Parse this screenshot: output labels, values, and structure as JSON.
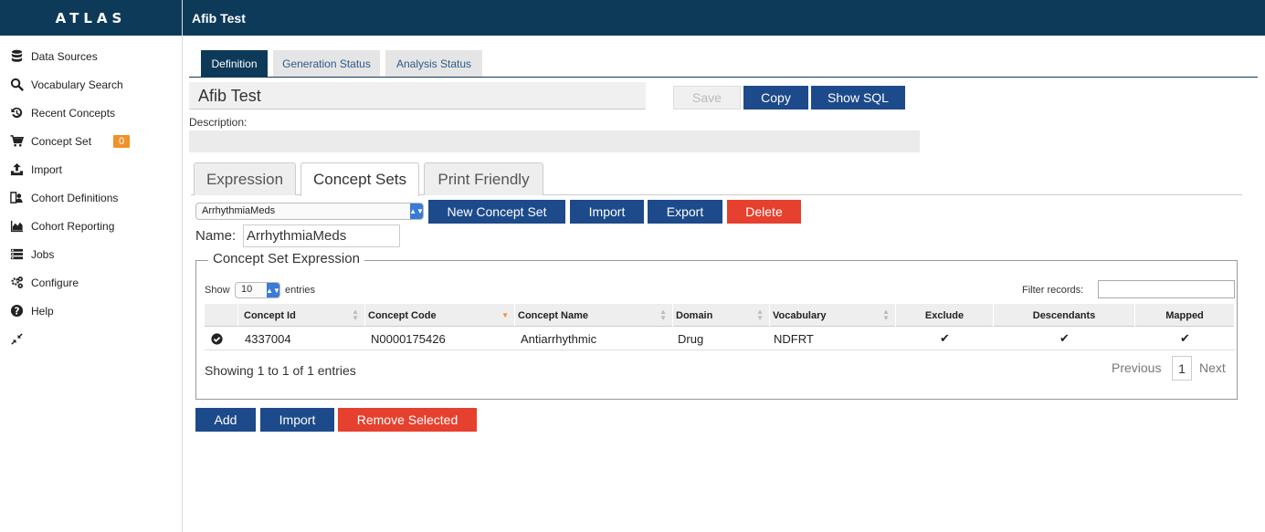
{
  "app": {
    "logo": "ATLAS",
    "page_title": "Afib Test"
  },
  "sidebar": {
    "items": [
      {
        "label": "Data Sources",
        "icon": "database-icon"
      },
      {
        "label": "Vocabulary Search",
        "icon": "search-icon"
      },
      {
        "label": "Recent Concepts",
        "icon": "history-icon"
      },
      {
        "label": "Concept Set",
        "icon": "cart-icon",
        "badge": "0"
      },
      {
        "label": "Import",
        "icon": "upload-icon"
      },
      {
        "label": "Cohort Definitions",
        "icon": "cohort-icon"
      },
      {
        "label": "Cohort Reporting",
        "icon": "area-chart-icon"
      },
      {
        "label": "Jobs",
        "icon": "list-icon"
      },
      {
        "label": "Configure",
        "icon": "gears-icon"
      },
      {
        "label": "Help",
        "icon": "question-icon"
      },
      {
        "label": "",
        "icon": "compress-icon"
      }
    ]
  },
  "top_tabs": [
    "Definition",
    "Generation Status",
    "Analysis Status"
  ],
  "definition": {
    "title": "Afib Test",
    "save_label": "Save",
    "copy_label": "Copy",
    "show_sql_label": "Show SQL",
    "description_label": "Description:",
    "description_value": ""
  },
  "inner_tabs": [
    "Expression",
    "Concept Sets",
    "Print Friendly"
  ],
  "concept_sets": {
    "selected": "ArrhythmiaMeds",
    "new_label": "New Concept Set",
    "import_label": "Import",
    "export_label": "Export",
    "delete_label": "Delete",
    "name_label": "Name:",
    "name_value": "ArrhythmiaMeds",
    "legend": "Concept Set Expression",
    "show_label": "Show",
    "page_length": "10",
    "entries_label": "entries",
    "filter_label": "Filter records:",
    "columns": [
      "",
      "Concept Id",
      "Concept Code",
      "Concept Name",
      "Domain",
      "Vocabulary",
      "Exclude",
      "Descendants",
      "Mapped"
    ],
    "rows": [
      {
        "concept_id": "4337004",
        "concept_code": "N0000175426",
        "concept_name": "Antiarrhythmic",
        "domain": "Drug",
        "vocabulary": "NDFRT",
        "exclude": "✔",
        "descendants": "✔",
        "mapped": "✔"
      }
    ],
    "info": "Showing 1 to 1 of 1 entries",
    "previous_label": "Previous",
    "current_page": "1",
    "next_label": "Next",
    "add_label": "Add",
    "import_bottom_label": "Import",
    "remove_label": "Remove Selected"
  },
  "colors": {
    "header": "#0e3a5a",
    "primary_button": "#1d4a8a",
    "danger_button": "#e6402f",
    "badge": "#f0912b"
  }
}
